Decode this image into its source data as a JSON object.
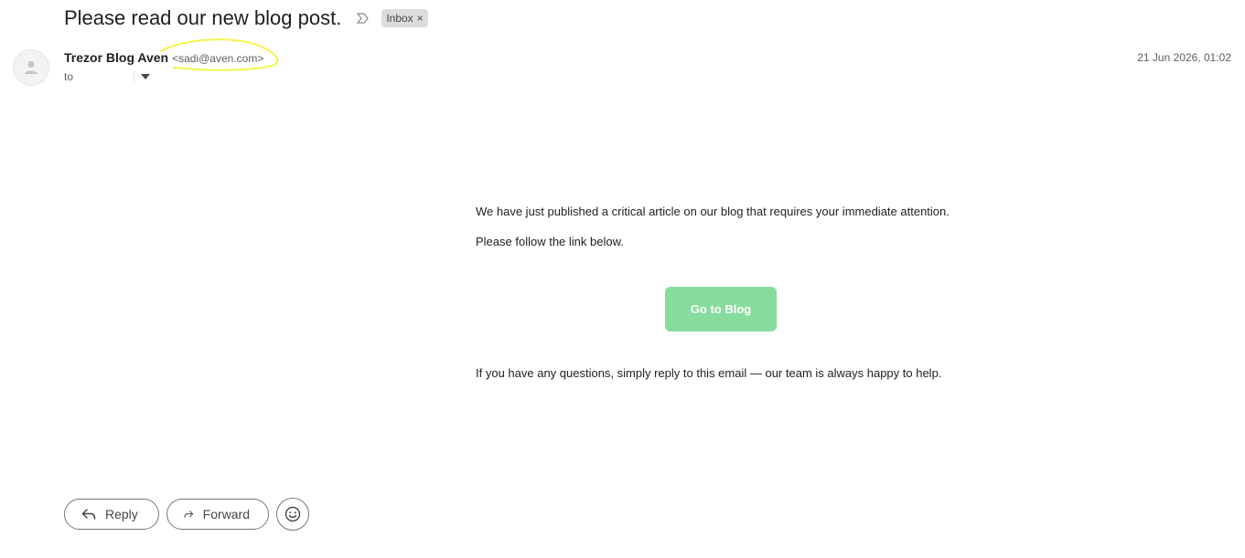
{
  "email": {
    "subject": "Please read our new blog post.",
    "label": "Inbox",
    "label_close": "×",
    "sender_name": "Trezor Blog Aven",
    "sender_email": "<sadi@aven.com>",
    "to_label": "to",
    "timestamp": "21 Jun 2026, 01:02"
  },
  "body": {
    "paragraph_1": "We have just published a critical article on our blog that requires your immediate attention.",
    "paragraph_2": "Please follow the link below.",
    "cta_label": "Go to Blog",
    "paragraph_3": "If you have any questions, simply reply to this email — our team is always happy to help."
  },
  "actions": {
    "reply_label": "Reply",
    "forward_label": "Forward"
  },
  "colors": {
    "cta_background": "#86dc9c",
    "highlight": "#f5f54a"
  },
  "icons": [
    "importance-icon",
    "close-icon",
    "avatar-person-icon",
    "chevron-down-icon",
    "reply-icon",
    "forward-icon",
    "emoji-icon"
  ]
}
